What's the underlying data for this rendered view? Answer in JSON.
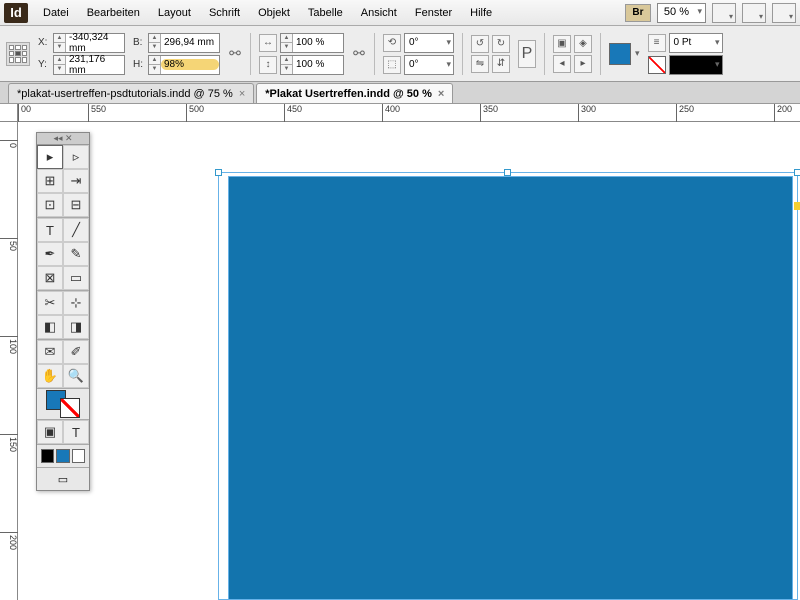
{
  "app": {
    "logo": "Id"
  },
  "menu": [
    "Datei",
    "Bearbeiten",
    "Layout",
    "Schrift",
    "Objekt",
    "Tabelle",
    "Ansicht",
    "Fenster",
    "Hilfe"
  ],
  "menubar_right": {
    "br": "Br",
    "zoom": "50 %"
  },
  "control": {
    "x": "-340,324 mm",
    "y": "231,176 mm",
    "b": "296,94 mm",
    "h": "98%",
    "scale_x": "100 %",
    "scale_y": "100 %",
    "rotate": "0°",
    "shear": "0°",
    "stroke_weight": "0 Pt"
  },
  "tabs": [
    {
      "label": "*plakat-usertreffen-psdtutorials.indd @ 75 %",
      "active": false
    },
    {
      "label": "*Plakat Usertreffen.indd @ 50 %",
      "active": true
    }
  ],
  "ruler_h": [
    {
      "pos": 0,
      "label": "00"
    },
    {
      "pos": 70,
      "label": "550"
    },
    {
      "pos": 168,
      "label": "500"
    },
    {
      "pos": 266,
      "label": "450"
    },
    {
      "pos": 364,
      "label": "400"
    },
    {
      "pos": 462,
      "label": "350"
    },
    {
      "pos": 560,
      "label": "300"
    },
    {
      "pos": 658,
      "label": "250"
    },
    {
      "pos": 756,
      "label": "200"
    }
  ],
  "ruler_v": [
    {
      "pos": 18,
      "label": "0"
    },
    {
      "pos": 116,
      "label": "50"
    },
    {
      "pos": 214,
      "label": "100"
    },
    {
      "pos": 312,
      "label": "150"
    },
    {
      "pos": 410,
      "label": "200"
    }
  ],
  "tools": [
    "select",
    "direct-select",
    "page",
    "gap",
    "content",
    "type",
    "line",
    "pen",
    "pencil",
    "rect-frame",
    "rect",
    "scissors",
    "transform",
    "gradient-swatch",
    "gradient-feather",
    "note",
    "eyedropper",
    "hand",
    "zoom"
  ]
}
